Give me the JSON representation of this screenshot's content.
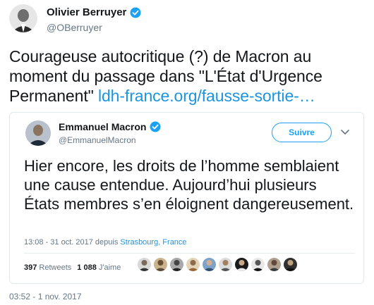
{
  "tweet": {
    "author_name": "Olivier Berruyer",
    "author_handle": "@OBerruyer",
    "text": "Courageuse autocritique (?) de Macron au moment du passage dans \"L'État d'Urgence Permanent\" ",
    "link": "ldh-france.org/fausse-sortie-…",
    "timestamp": "03:52 - 1 nov. 2017"
  },
  "quoted_tweet": {
    "author_name": "Emmanuel Macron",
    "author_handle": "@EmmanuelMacron",
    "follow_label": "Suivre",
    "text": "Hier encore, les droits de l’homme semblaient une cause entendue. Aujourd’hui plusieurs États membres s’en éloignent dangereusement.",
    "meta_time": "13:08 - 31 oct. 2017 depuis ",
    "meta_place": "Strasbourg, France",
    "retweets_count": "397",
    "retweets_label": "Retweets",
    "likes_count": "1 088",
    "likes_label": "J'aime"
  },
  "colors": {
    "link": "#1b95e0",
    "verified": "#1da1f2",
    "secondary_text": "#657786"
  },
  "icons": [
    "verified-badge-icon",
    "chevron-down-icon"
  ]
}
